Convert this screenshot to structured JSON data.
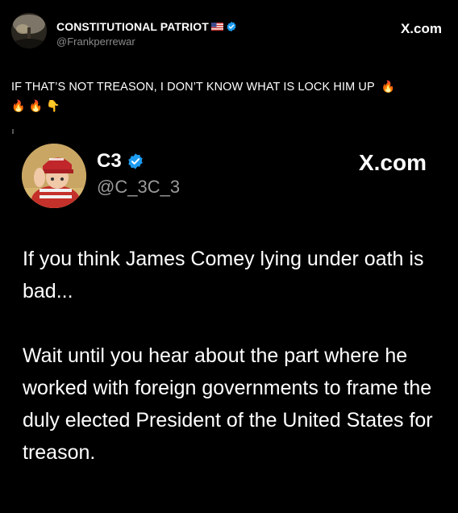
{
  "outer_post": {
    "author_name": "CONSTITUTIONAL PATRIOT",
    "author_handle": "@Frankperrewar",
    "site_label": "X.com",
    "text": "IF THAT’S NOT TREASON, I DON’T KNOW WHAT IS LOCK HIM UP",
    "emojis_inline": "🔥",
    "emojis_line2": [
      "🔥",
      "🔥",
      "👇"
    ]
  },
  "quoted_post": {
    "author_name": "C3",
    "author_handle": "@C_3C_3",
    "site_label": "X.com",
    "paragraph_1": "If you think James Comey lying under oath is bad...",
    "paragraph_2": "Wait until you hear about the part where he worked with foreign governments to frame the duly elected President of the United States for treason."
  },
  "icons": {
    "verified": "verified-badge-icon",
    "flag": "us-flag-icon",
    "fire": "fire-icon",
    "pointing_down": "pointing-down-icon"
  },
  "colors": {
    "background": "#000000",
    "verified_blue": "#1d9bf0",
    "muted_text": "#8b8b8b"
  }
}
